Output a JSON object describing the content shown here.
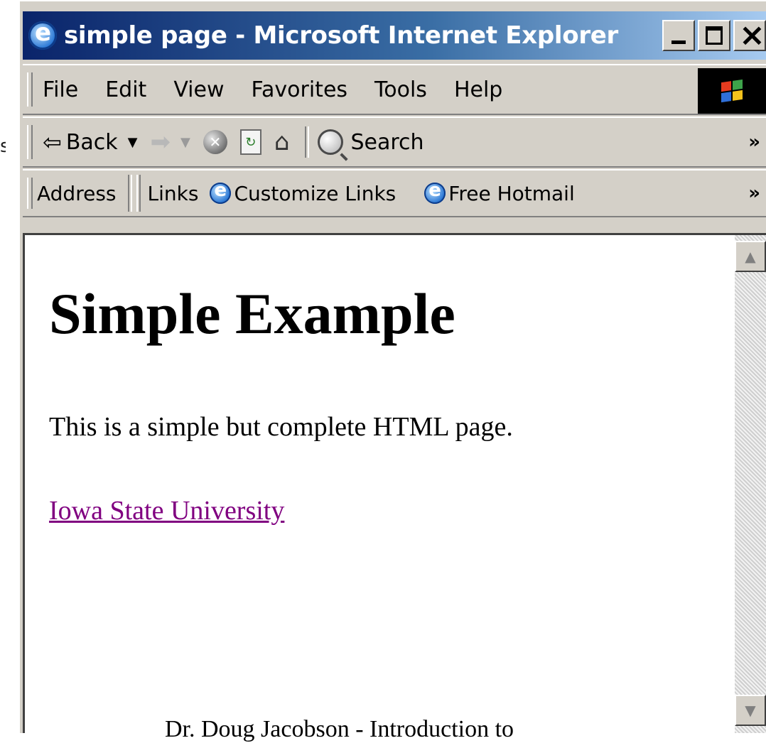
{
  "window": {
    "title": "simple page - Microsoft Internet Explorer",
    "edge_mark": "s"
  },
  "menubar": {
    "items": [
      "File",
      "Edit",
      "View",
      "Favorites",
      "Tools",
      "Help"
    ]
  },
  "toolbar": {
    "back_label": "Back",
    "search_label": "Search",
    "overflow": "»"
  },
  "addressbar": {
    "address_label": "Address",
    "links_label": "Links",
    "link1": "Customize Links",
    "link2": "Free Hotmail",
    "overflow": "»"
  },
  "page": {
    "heading": "Simple Example",
    "paragraph": "This is a simple but complete HTML page.",
    "link_text": "Iowa State University",
    "link_color": "#800080"
  },
  "caption": {
    "text": "Dr. Doug Jacobson - Introduction to"
  },
  "colors": {
    "titlebar_start": "#0a246a",
    "chrome": "#d4d0c8"
  }
}
